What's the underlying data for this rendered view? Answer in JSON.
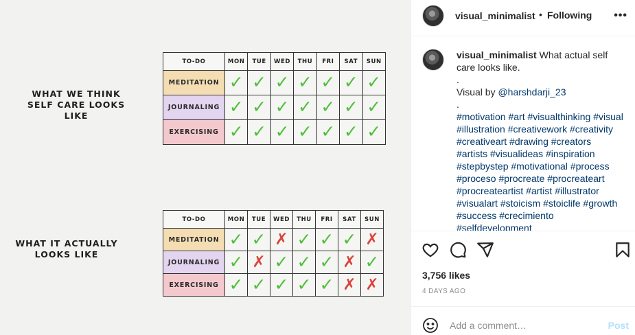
{
  "artwork": {
    "caption_top": "WHAT WE THINK SELF CARE LOOKS LIKE",
    "caption_bottom": "WHAT IT ACTUALLY LOOKS LIKE",
    "header_label": "TO-DO",
    "days": [
      "MON",
      "TUE",
      "WED",
      "THU",
      "FRI",
      "SAT",
      "SUN"
    ],
    "rows": [
      {
        "label": "MEDITATION",
        "color": "#f5ddb3"
      },
      {
        "label": "JOURNALING",
        "color": "#e3d5f0"
      },
      {
        "label": "EXERCISING",
        "color": "#f3c9cd"
      }
    ],
    "expected": [
      [
        "yes",
        "yes",
        "yes",
        "yes",
        "yes",
        "yes",
        "yes"
      ],
      [
        "yes",
        "yes",
        "yes",
        "yes",
        "yes",
        "yes",
        "yes"
      ],
      [
        "yes",
        "yes",
        "yes",
        "yes",
        "yes",
        "yes",
        "yes"
      ]
    ],
    "actual": [
      [
        "yes",
        "yes",
        "no",
        "yes",
        "yes",
        "yes",
        "no"
      ],
      [
        "yes",
        "no",
        "yes",
        "yes",
        "yes",
        "no",
        "yes"
      ],
      [
        "yes",
        "yes",
        "yes",
        "yes",
        "yes",
        "no",
        "no"
      ]
    ],
    "check_color": "#4fbf3a",
    "cross_color": "#d9433a"
  },
  "header": {
    "username": "visual_minimalist",
    "separator": "•",
    "follow_label": "Following",
    "more_icon": "more-horizontal-icon"
  },
  "caption": {
    "username": "visual_minimalist",
    "text": "What actual self care looks like.",
    "dot1": ".",
    "credit_prefix": "Visual by ",
    "credit_handle": "@harshdarji_23",
    "dot2": ".",
    "hashtags": [
      "#motivation",
      "#art",
      "#visualthinking",
      "#visual",
      "#illustration",
      "#creativework",
      "#creativity",
      "#creativeart",
      "#drawing",
      "#creators",
      "#artists",
      "#visualideas",
      "#inspiration",
      "#stepbystep",
      "#motivational",
      "#process",
      "#proceso",
      "#procreate",
      "#procreateart",
      "#procreateartist",
      "#artist",
      "#illustrator",
      "#visualart",
      "#stoicism",
      "#stoiclife",
      "#growth",
      "#success",
      "#crecimiento",
      "#selfdevelopment"
    ]
  },
  "actions": {
    "icons": [
      "heart-icon",
      "comment-icon",
      "share-icon",
      "save-icon"
    ]
  },
  "likes_text": "3,756 likes",
  "date_text": "4 DAYS AGO",
  "comment": {
    "placeholder": "Add a comment…",
    "post_label": "Post",
    "emoji_icon": "emoji-icon"
  }
}
